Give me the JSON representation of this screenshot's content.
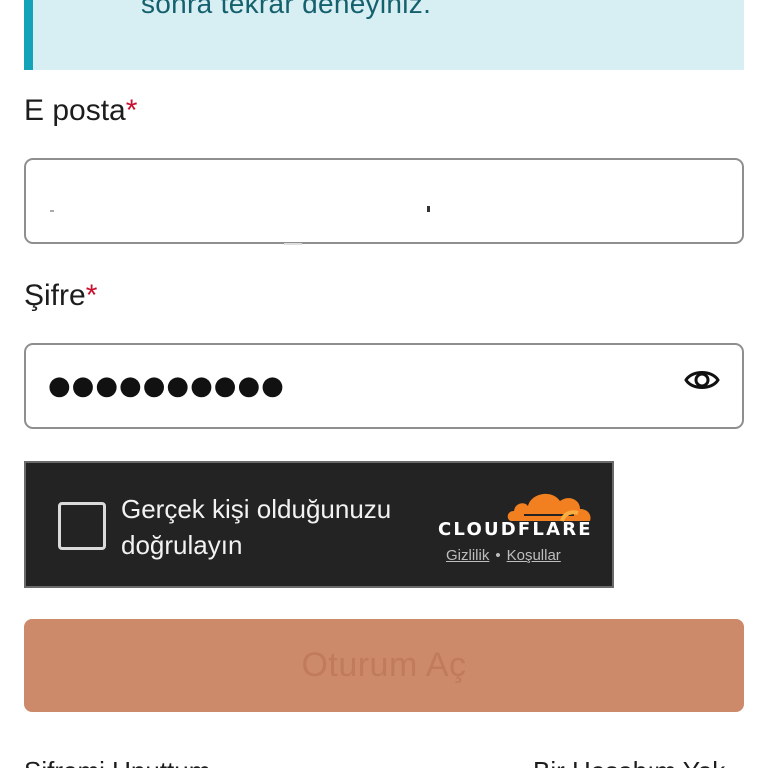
{
  "alert": {
    "text": "sonra tekrar deneyiniz."
  },
  "email": {
    "label": "E posta",
    "required_mark": "*"
  },
  "password": {
    "label": "Şifre",
    "required_mark": "*",
    "masked_value": "●●●●●●●●●●"
  },
  "turnstile": {
    "prompt": "Gerçek kişi olduğunuzu doğrulayın",
    "brand": "CLOUDFLARE",
    "privacy_link": "Gizlilik",
    "separator": "•",
    "terms_link": "Koşullar"
  },
  "submit": {
    "label": "Oturum Aç"
  },
  "footer": {
    "forgot_label": "Şifremi Unuttum",
    "other_label": "Bir Hesabım Yok"
  },
  "colors": {
    "alert_bg": "#d7eef3",
    "alert_accent": "#12a3b8",
    "required": "#c8102e",
    "submit_bg": "#cd8a6a",
    "cloudflare_orange": "#f38020"
  }
}
